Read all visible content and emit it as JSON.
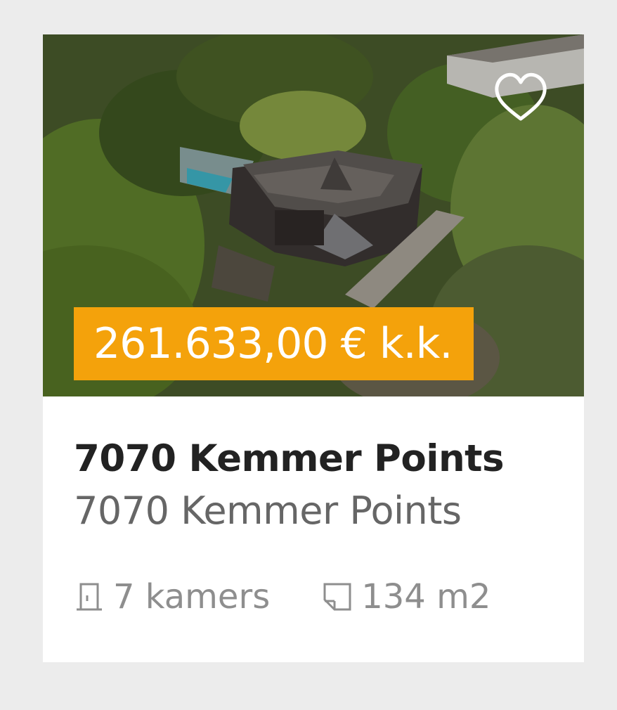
{
  "listing": {
    "price": "261.633,00 € k.k.",
    "title": "7070 Kemmer Points",
    "address": "7070 Kemmer Points",
    "rooms": "7 kamers",
    "area": "134 m2",
    "icons": {
      "favorite": "heart-icon",
      "rooms": "door-icon",
      "area": "floor-area-icon"
    }
  },
  "colors": {
    "price_badge": "#f4a20b",
    "title": "#222222",
    "address": "#666666",
    "features": "#8e8e8e",
    "background": "#ececec",
    "card": "#ffffff"
  }
}
